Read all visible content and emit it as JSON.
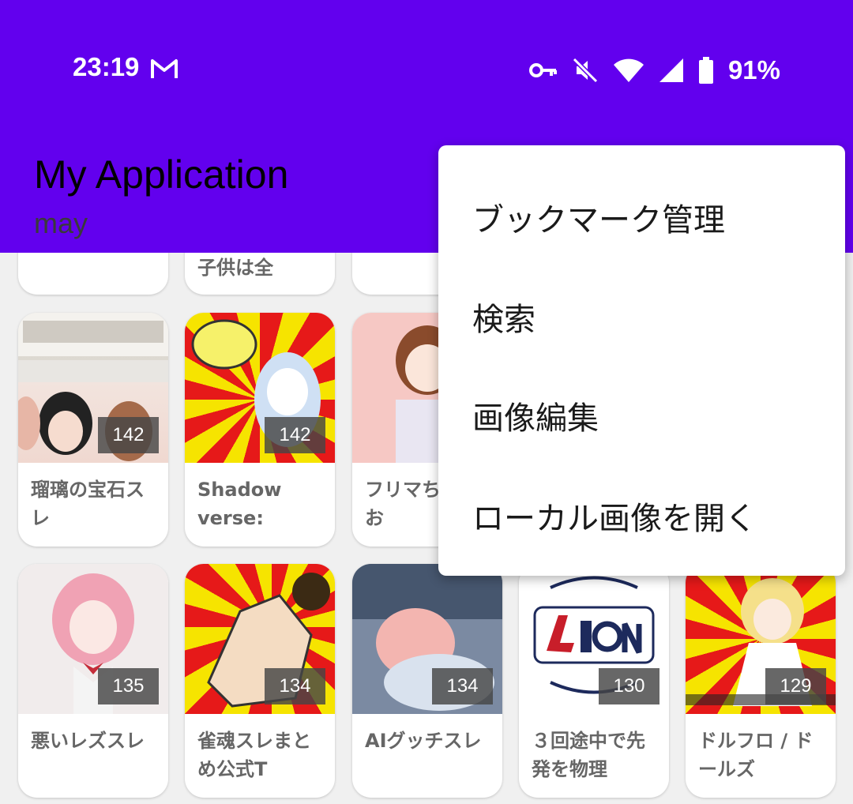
{
  "status_bar": {
    "time": "23:19",
    "battery": "91%"
  },
  "app": {
    "title": "My Application",
    "subtitle": "may"
  },
  "top_row": [
    {
      "title": ""
    },
    {
      "title": "子供は全"
    },
    {
      "title": ""
    }
  ],
  "row2": [
    {
      "count": "142",
      "title": "瑠璃の宝石スレ"
    },
    {
      "count": "142",
      "title": "Shadow verse: Worl..."
    },
    {
      "count": "",
      "title": "フリマちスレ お"
    }
  ],
  "row3": [
    {
      "count": "135",
      "title": "悪いレズスレ"
    },
    {
      "count": "134",
      "title": "雀魂スレまとめ公式T"
    },
    {
      "count": "134",
      "title": "AIグッチスレ"
    },
    {
      "count": "130",
      "title": "３回途中で先発を物理"
    },
    {
      "count": "129",
      "title": "ドルフロ / ドールズ"
    }
  ],
  "menu": {
    "items": [
      "ブックマーク管理",
      "検索",
      "画像編集",
      "ローカル画像を開く"
    ]
  },
  "colors": {
    "primary": "#6200ee",
    "menu_bg": "#ffffff"
  }
}
